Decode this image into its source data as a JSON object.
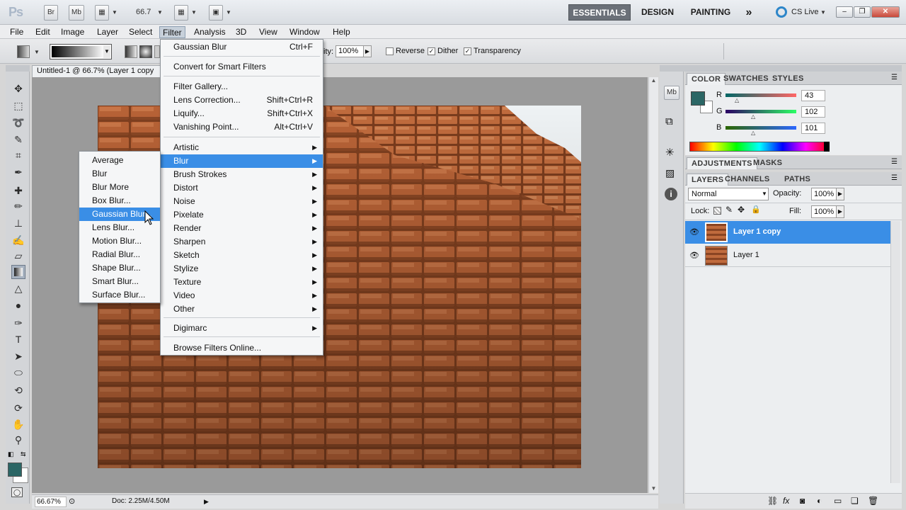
{
  "appbar": {
    "logo": "Ps",
    "br": "Br",
    "mb": "Mb",
    "zoom": "66.7",
    "workspaces": [
      "ESSENTIALS",
      "DESIGN",
      "PAINTING"
    ],
    "more": "»",
    "cslive": "CS Live"
  },
  "menubar": [
    "File",
    "Edit",
    "Image",
    "Layer",
    "Select",
    "Filter",
    "Analysis",
    "3D",
    "View",
    "Window",
    "Help"
  ],
  "options": {
    "opacity_label": "ity:",
    "opacity_value": "100%",
    "reverse": "Reverse",
    "dither": "Dither",
    "transparency": "Transparency"
  },
  "document": {
    "tab": "Untitled-1 @ 66.7% (Layer 1 copy",
    "zoom_status": "66.67%",
    "doc_info": "Doc: 2.25M/4.50M"
  },
  "filter_menu": {
    "last_filter": {
      "label": "Gaussian Blur",
      "shortcut": "Ctrl+F"
    },
    "convert": "Convert for Smart Filters",
    "group2": [
      {
        "label": "Filter Gallery...",
        "shortcut": ""
      },
      {
        "label": "Lens Correction...",
        "shortcut": "Shift+Ctrl+R"
      },
      {
        "label": "Liquify...",
        "shortcut": "Shift+Ctrl+X"
      },
      {
        "label": "Vanishing Point...",
        "shortcut": "Alt+Ctrl+V"
      }
    ],
    "submenus": [
      "Artistic",
      "Blur",
      "Brush Strokes",
      "Distort",
      "Noise",
      "Pixelate",
      "Render",
      "Sharpen",
      "Sketch",
      "Stylize",
      "Texture",
      "Video",
      "Other"
    ],
    "digimarc": "Digimarc",
    "browse": "Browse Filters Online..."
  },
  "blur_menu": [
    "Average",
    "Blur",
    "Blur More",
    "Box Blur...",
    "Gaussian Blur...",
    "Lens Blur...",
    "Motion Blur...",
    "Radial Blur...",
    "Shape Blur...",
    "Smart Blur...",
    "Surface Blur..."
  ],
  "color_panel": {
    "tabs": [
      "COLOR",
      "SWATCHES",
      "STYLES"
    ],
    "channels": [
      {
        "label": "R",
        "value": "43",
        "fraction": 0.17
      },
      {
        "label": "G",
        "value": "102",
        "fraction": 0.4
      },
      {
        "label": "B",
        "value": "101",
        "fraction": 0.4
      }
    ],
    "foreground": "#2b6665",
    "background": "#ffffff"
  },
  "adjust_panel": {
    "tabs": [
      "ADJUSTMENTS",
      "MASKS"
    ]
  },
  "layers_panel": {
    "tabs": [
      "LAYERS",
      "CHANNELS",
      "PATHS"
    ],
    "blend_mode": "Normal",
    "opacity_label": "Opacity:",
    "opacity_value": "100%",
    "lock_label": "Lock:",
    "fill_label": "Fill:",
    "fill_value": "100%",
    "layers": [
      "Layer 1 copy",
      "Layer 1"
    ]
  },
  "colors": {
    "accent": "#3a8ee6",
    "menu_bg": "#f5f6f7",
    "selected_layer": "#3a8ee6"
  }
}
